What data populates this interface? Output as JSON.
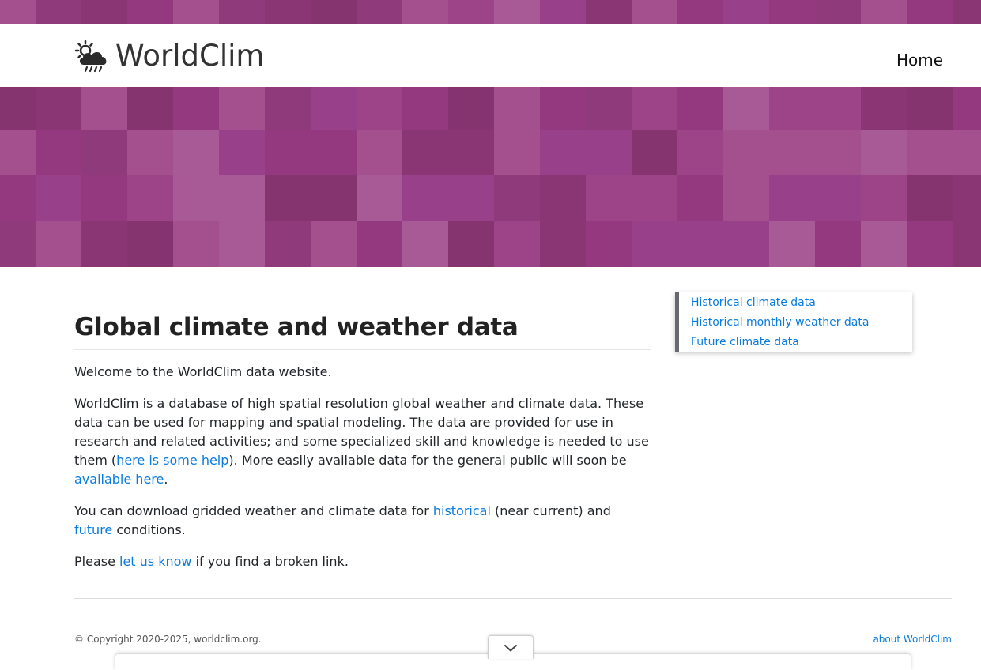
{
  "brand": {
    "name": "WorldClim",
    "icon": "weather-sun-cloud-rain-icon"
  },
  "nav": {
    "home_label": "Home"
  },
  "theme": {
    "accent": "#94397f",
    "link": "#0a7be0",
    "sidebar_border": "#666a70"
  },
  "main": {
    "title": "Global climate and weather data",
    "welcome": "Welcome to the WorldClim data website.",
    "p2": {
      "text_a": "WorldClim is a database of high spatial resolution global weather and climate data. These data can be used for mapping and spatial modeling. The data are provided for use in research and related activities; and some specialized skill and knowledge is needed to use them (",
      "link_help": "here is some help",
      "text_b": "). More easily available data for the general public will soon be ",
      "link_available": "available here",
      "text_c": "."
    },
    "p3": {
      "text_a": "You can download gridded weather and climate data for ",
      "link_historical": "historical",
      "text_b": " (near current) and ",
      "link_future": "future",
      "text_c": " conditions."
    },
    "p4": {
      "text_a": "Please ",
      "link_contact": "let us know",
      "text_b": " if you find a broken link."
    }
  },
  "sidebar": {
    "items": [
      {
        "label": "Historical climate data"
      },
      {
        "label": "Historical monthly weather data"
      },
      {
        "label": "Future climate data"
      }
    ]
  },
  "footer": {
    "copyright": "© Copyright 2020-2025, worldclim.org.",
    "about_label": "about WorldClim"
  },
  "overlay": {
    "toggle_icon": "chevron-down-icon"
  }
}
